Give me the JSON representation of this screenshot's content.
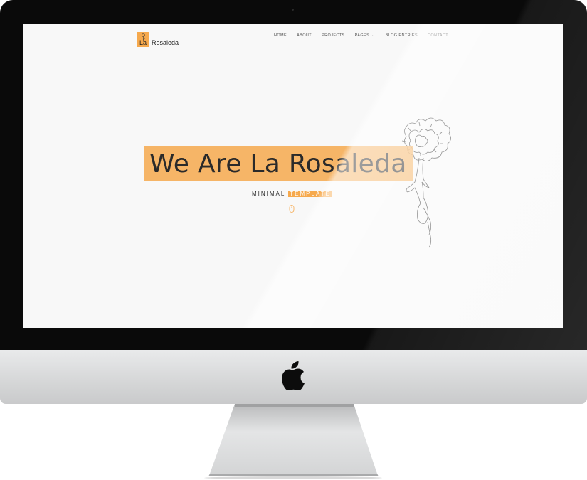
{
  "site": {
    "logo_la": "La",
    "logo_rest": "Rosaleda"
  },
  "nav": {
    "items": [
      {
        "label": "HOME"
      },
      {
        "label": "ABOUT"
      },
      {
        "label": "PROJECTS"
      },
      {
        "label": "PAGES",
        "has_dropdown": true
      },
      {
        "label": "BLOG ENTRIES"
      },
      {
        "label": "CONTACT"
      }
    ]
  },
  "hero": {
    "title": "We Are La Rosaleda",
    "subtitle_plain": "MINIMAL",
    "subtitle_highlight": "TEMPLATE"
  },
  "colors": {
    "accent": "#f6a94d",
    "screen_bg": "#f8f8f8",
    "bezel": "#0a0a0a",
    "chin": "#dadbdc"
  },
  "icons": {
    "logo": "rose-icon",
    "scroll": "mouse-scroll-icon",
    "decor": "carnation-flower-illustration",
    "brand": "apple-logo"
  }
}
